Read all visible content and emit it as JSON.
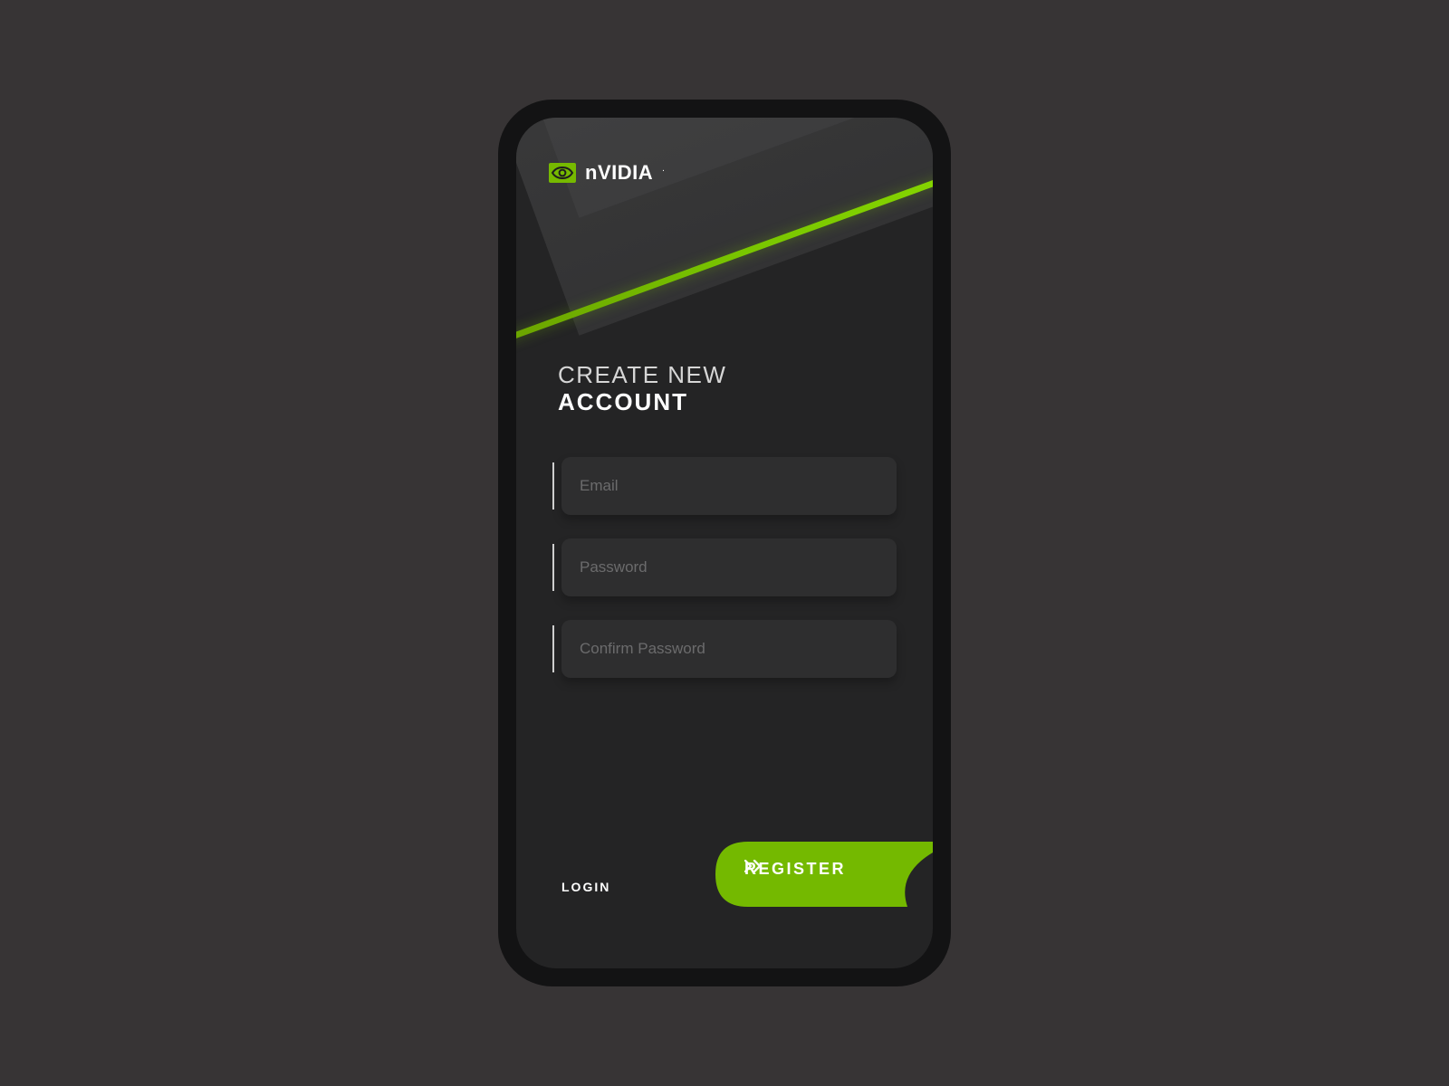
{
  "brand": {
    "name": "NVIDIA",
    "accent_color": "#76b900"
  },
  "heading": {
    "line1": "CREATE NEW",
    "line2": "ACCOUNT"
  },
  "form": {
    "email_placeholder": "Email",
    "password_placeholder": "Password",
    "confirm_placeholder": "Confirm Password"
  },
  "actions": {
    "login_label": "LOGIN",
    "register_label": "REGISTER"
  },
  "colors": {
    "bg": "#373435",
    "phone": "#131314",
    "screen": "#242425",
    "field": "#2e2e2f",
    "accent": "#76b900"
  }
}
